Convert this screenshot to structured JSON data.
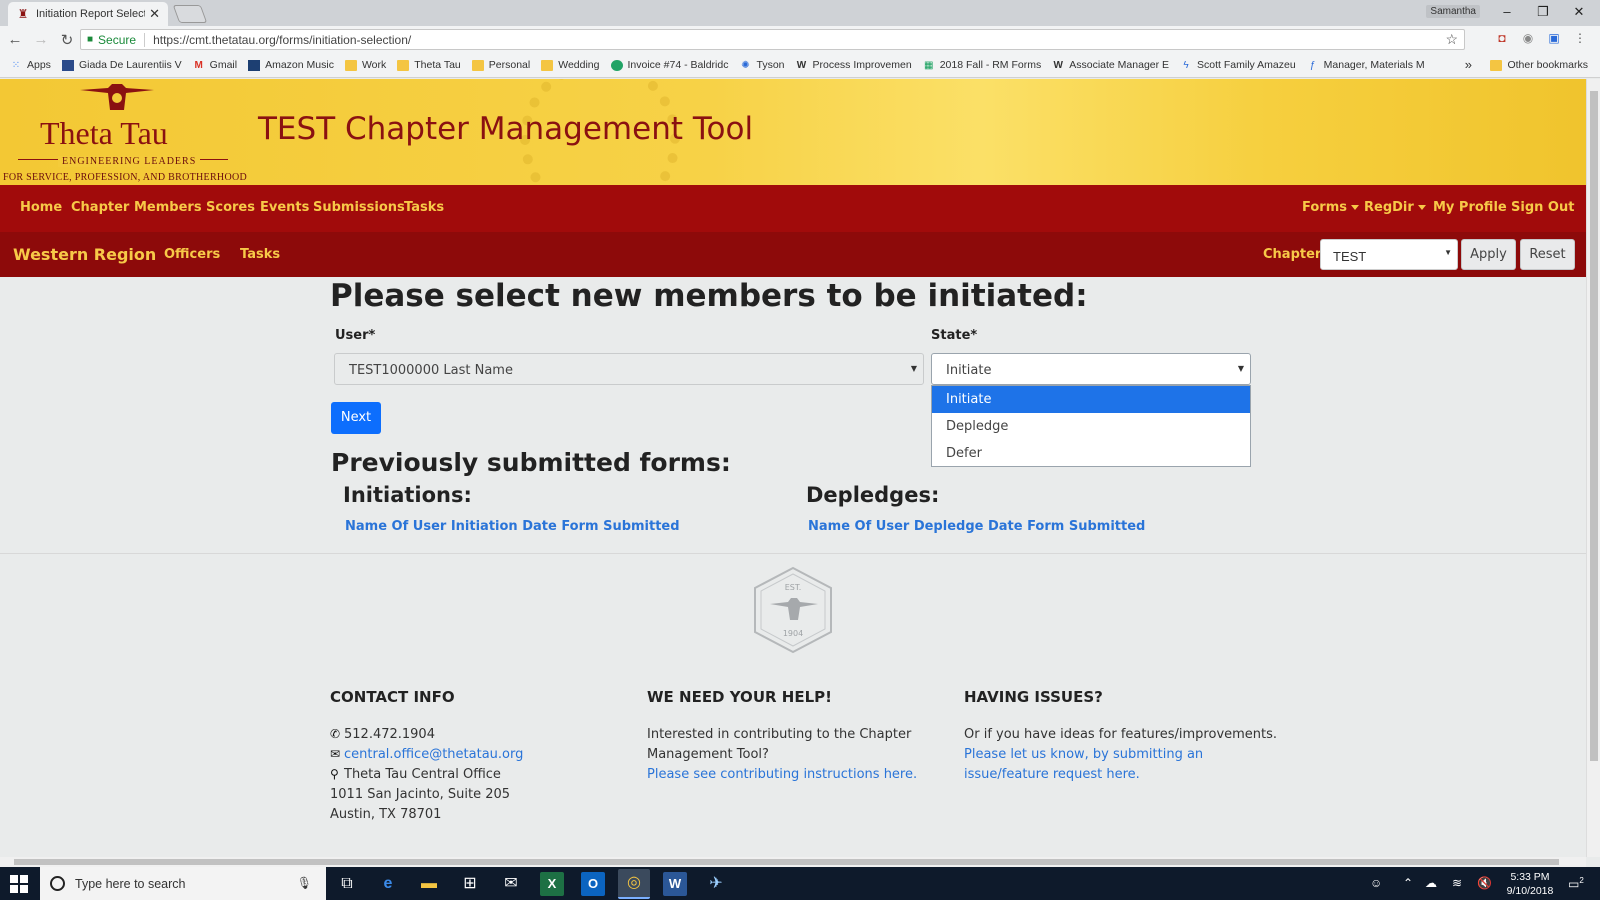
{
  "browser": {
    "tab_title": "Initiation Report Selectio",
    "user": "Samantha",
    "secure_label": "Secure",
    "url": "https://cmt.thetatau.org/forms/initiation-selection/",
    "bookmarks": [
      {
        "label": "Apps",
        "icon": "apps-grid"
      },
      {
        "label": "Giada De Laurentiis V",
        "icon": "site"
      },
      {
        "label": "Gmail",
        "icon": "gmail-m"
      },
      {
        "label": "Amazon Music",
        "icon": "amazon"
      },
      {
        "label": "Work",
        "icon": "folder"
      },
      {
        "label": "Theta Tau",
        "icon": "folder"
      },
      {
        "label": "Personal",
        "icon": "folder"
      },
      {
        "label": "Wedding",
        "icon": "folder"
      },
      {
        "label": "Invoice #74 - Baldridc",
        "icon": "site"
      },
      {
        "label": "Tyson",
        "icon": "site"
      },
      {
        "label": "Process Improvemen",
        "icon": "site"
      },
      {
        "label": "2018 Fall - RM Forms",
        "icon": "sheet"
      },
      {
        "label": "Associate Manager E",
        "icon": "site"
      },
      {
        "label": "Scott Family Amazeu",
        "icon": "site"
      },
      {
        "label": "Manager, Materials M",
        "icon": "site"
      }
    ],
    "other_bookmarks": "Other bookmarks"
  },
  "header": {
    "logo_name": "Theta Tau",
    "logo_tagline1": "ENGINEERING LEADERS",
    "logo_tagline2": "FOR SERVICE, PROFESSION, AND BROTHERHOOD",
    "title": "TEST Chapter Management Tool"
  },
  "nav": {
    "left": [
      "Home",
      "Chapter",
      "Members",
      "Scores",
      "Events",
      "Submissions",
      "Tasks"
    ],
    "forms": "Forms",
    "regdir": "RegDir",
    "profile": "My Profile",
    "signout": "Sign Out"
  },
  "subnav": {
    "region": "Western Region",
    "officers": "Officers",
    "tasks": "Tasks",
    "chapter_label": "Chapter*",
    "chapter_value": "TEST",
    "apply": "Apply",
    "reset": "Reset"
  },
  "form": {
    "heading": "Please select new members to be initiated:",
    "user_label": "User*",
    "user_value": "TEST1000000 Last Name",
    "state_label": "State*",
    "state_value": "Initiate",
    "state_options": [
      "Initiate",
      "Depledge",
      "Defer"
    ],
    "next": "Next"
  },
  "previous": {
    "heading": "Previously submitted forms:",
    "initiations_heading": "Initiations:",
    "initiations_cols": "Name Of User Initiation Date Form Submitted",
    "depledges_heading": "Depledges:",
    "depledges_cols": "Name Of User Depledge Date Form Submitted"
  },
  "footer": {
    "seal_top": "EST.",
    "seal_year": "1904",
    "contact": {
      "heading": "CONTACT INFO",
      "phone": "512.472.1904",
      "email": "central.office@thetatau.org",
      "office": "Theta Tau Central Office",
      "street": "1011 San Jacinto, Suite 205",
      "city": "Austin, TX 78701"
    },
    "help": {
      "heading": "WE NEED YOUR HELP!",
      "line1": "Interested in contributing to the Chapter",
      "line2": "Management Tool?",
      "link": "Please see contributing instructions here."
    },
    "issues": {
      "heading": "HAVING ISSUES?",
      "line1": "Or if you have ideas for features/improvements.",
      "link1": "Please let us know, by submitting an",
      "link2": "issue/feature request here."
    }
  },
  "taskbar": {
    "search_placeholder": "Type here to search",
    "time": "5:33 PM",
    "date": "9/10/2018",
    "notifications": "2"
  },
  "colors": {
    "header_gold": "#f6cf3e",
    "nav_red": "#a10b0b",
    "subnav_red": "#8d0a0a",
    "nav_text": "#f7c948",
    "brand_maroon": "#8a1111",
    "primary_blue": "#0d6efd",
    "link_blue": "#2a74d8"
  }
}
